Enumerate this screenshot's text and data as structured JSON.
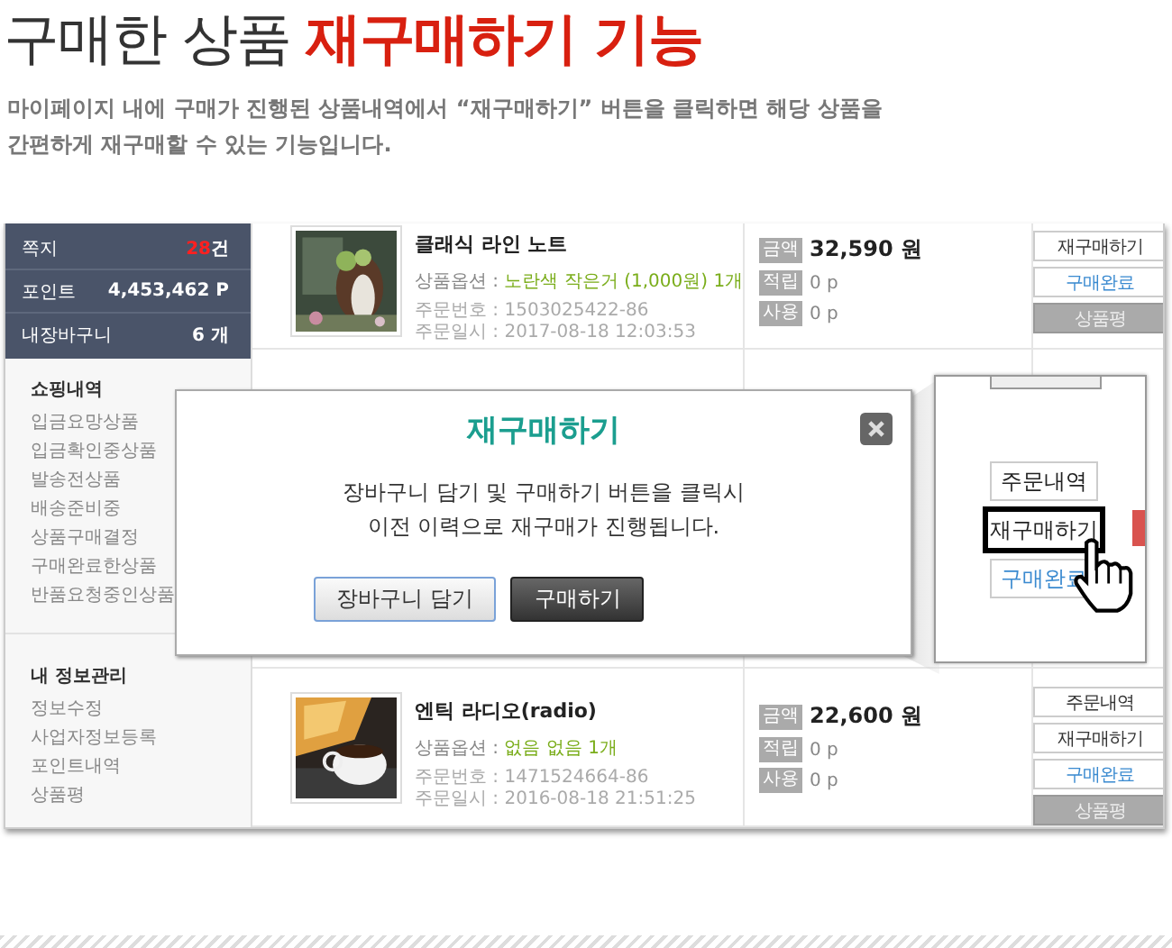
{
  "heading": {
    "plain": "구매한 상품",
    "highlight": "재구매하기 기능"
  },
  "description": [
    "마이페이지 내에 구매가 진행된 상품내역에서 “재구매하기” 버튼을 클릭하면 해당 상품을",
    "간편하게 재구매할 수 있는 기능입니다."
  ],
  "stats": [
    {
      "label": "쪽지",
      "value": "28",
      "unit": "건",
      "alert": true
    },
    {
      "label": "포인트",
      "value": "4,453,462 P",
      "alert": false
    },
    {
      "label": "내장바구니",
      "value": "6 개",
      "alert": false
    }
  ],
  "menus": [
    {
      "title": "쇼핑내역",
      "items": [
        "입금요망상품",
        "입금확인중상품",
        "발송전상품",
        "배송준비중",
        "상품구매결정",
        "구매완료한상품",
        "반품요청중인상품"
      ]
    },
    {
      "title": "내 정보관리",
      "items": [
        "정보수정",
        "사업자정보등록",
        "포인트내역",
        "상품평"
      ]
    }
  ],
  "orders": [
    {
      "kind": "item",
      "title": "클래식 라인 노트",
      "option_label": "상품옵션 :",
      "option": "노란색 작은거 (1,000원) 1개",
      "order_no": "주문번호 : 1503025422-86",
      "order_date": "주문일시 : 2017-08-18 12:03:53",
      "price_lines": [
        {
          "label": "금액",
          "value": "32,590 원"
        },
        {
          "label": "적립",
          "value": "0 p"
        },
        {
          "label": "사용",
          "value": "0 p"
        }
      ],
      "buttons": [
        {
          "label": "재구매하기",
          "kind": "plain"
        },
        {
          "label": "구매완료",
          "kind": "link"
        },
        {
          "label": "상품평",
          "kind": "grey"
        }
      ]
    },
    {
      "kind": "covered"
    },
    {
      "kind": "item",
      "title": "엔틱 라디오(radio)",
      "option_label": "상품옵션 :",
      "option": "없음 없음 1개",
      "order_no": "주문번호 : 1471524664-86",
      "order_date": "주문일시 : 2016-08-18 21:51:25",
      "price_lines": [
        {
          "label": "금액",
          "value": "22,600 원"
        },
        {
          "label": "적립",
          "value": "0 p"
        },
        {
          "label": "사용",
          "value": "0 p"
        }
      ],
      "buttons": [
        {
          "label": "주문내역",
          "kind": "plain"
        },
        {
          "label": "재구매하기",
          "kind": "plain"
        },
        {
          "label": "구매완료",
          "kind": "link"
        },
        {
          "label": "상품평",
          "kind": "grey"
        }
      ]
    }
  ],
  "popup": {
    "title": "재구매하기",
    "message": [
      "장바구니 담기 및 구매하기 버튼을 클릭시",
      "이전 이력으로 재구매가 진행됩니다."
    ],
    "buttons": [
      {
        "label": "장바구니 담기",
        "kind": "secondary"
      },
      {
        "label": "구매하기",
        "kind": "primary"
      }
    ]
  },
  "inset": {
    "buttons": [
      {
        "label": "주문내역",
        "kind": "plain",
        "highlighted": false
      },
      {
        "label": "재구매하기",
        "kind": "plain",
        "highlighted": true
      },
      {
        "label": "구매완료",
        "kind": "link",
        "highlighted": false
      }
    ]
  }
}
